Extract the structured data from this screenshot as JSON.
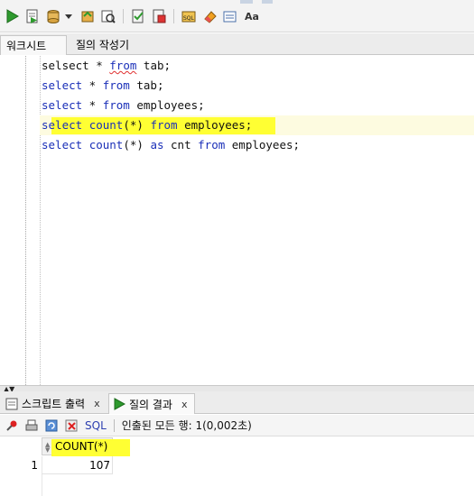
{
  "toolbar": {
    "icons": [
      "run-statement-icon",
      "run-script-icon",
      "commit-icon",
      "dropdown-icon",
      "rollback-icon",
      "autotrace-icon",
      "explain-plan-icon",
      "sql-tuning-icon",
      "unshared-sql-icon",
      "sql-worksheet-icon",
      "clear-icon",
      "text-case-icon"
    ],
    "case_label": "Aa"
  },
  "editor_tabs": {
    "worksheet": "워크시트",
    "query_builder": "질의 작성기"
  },
  "editor": {
    "lines": [
      {
        "parts": [
          {
            "t": "selsect ",
            "c": ""
          },
          {
            "t": "* ",
            "c": ""
          },
          {
            "t": "from",
            "c": "squig"
          },
          {
            "t": " tab;",
            "c": ""
          }
        ]
      },
      {
        "parts": [
          {
            "t": "select",
            "c": "kw"
          },
          {
            "t": " * ",
            "c": ""
          },
          {
            "t": "from",
            "c": "kw"
          },
          {
            "t": " tab;",
            "c": ""
          }
        ]
      },
      {
        "parts": [
          {
            "t": "select",
            "c": "kw"
          },
          {
            "t": " * ",
            "c": ""
          },
          {
            "t": "from",
            "c": "kw"
          },
          {
            "t": " employees;",
            "c": ""
          }
        ]
      },
      {
        "parts": [
          {
            "t": "select",
            "c": "kw"
          },
          {
            "t": " ",
            "c": ""
          },
          {
            "t": "count",
            "c": "kw"
          },
          {
            "t": "(*) ",
            "c": ""
          },
          {
            "t": "from",
            "c": "kw"
          },
          {
            "t": " employees;",
            "c": ""
          }
        ]
      },
      {
        "parts": [
          {
            "t": "select",
            "c": "kw"
          },
          {
            "t": " ",
            "c": ""
          },
          {
            "t": "count",
            "c": "kw"
          },
          {
            "t": "(*) ",
            "c": ""
          },
          {
            "t": "as",
            "c": "kw"
          },
          {
            "t": " cnt ",
            "c": ""
          },
          {
            "t": "from",
            "c": "kw"
          },
          {
            "t": " employees;",
            "c": ""
          }
        ]
      }
    ]
  },
  "bottom_tabs": {
    "script_output": "스크립트 출력",
    "query_result": "질의 결과",
    "close_label": "x"
  },
  "results_toolbar": {
    "sql_label": "SQL",
    "status": "인출된 모든 행: 1(0,002초)"
  },
  "grid": {
    "columns": [
      "COUNT(*)"
    ],
    "rows": [
      {
        "num": "1",
        "values": [
          "107"
        ]
      }
    ]
  },
  "colors": {
    "keyword": "#1a2fb8",
    "highlight": "#ffff33",
    "run_green": "#2e9a2e"
  }
}
